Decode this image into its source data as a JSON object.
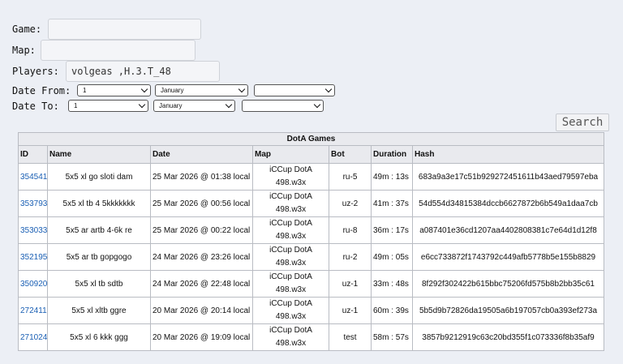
{
  "form": {
    "game_label": "Game:",
    "game_value": "",
    "map_label": "Map:",
    "map_value": "",
    "players_label": "Players:",
    "players_value": "volgeas ,H.3.T_48",
    "date_from_label": "Date From:",
    "date_to_label": "Date To:",
    "date_from": {
      "day": "1",
      "month": "January",
      "year": ""
    },
    "date_to": {
      "day": "1",
      "month": "January",
      "year": ""
    },
    "search_label": "Search"
  },
  "table": {
    "caption": "DotA Games",
    "headers": [
      "ID",
      "Name",
      "Date",
      "Map",
      "Bot",
      "Duration",
      "Hash"
    ],
    "rows": [
      {
        "id": "354541",
        "name": "5x5 xl go sloti dam",
        "date": "25 Mar 2026 @ 01:38 local",
        "map": "iCCup DotA 498.w3x",
        "bot": "ru-5",
        "duration": "49m : 13s",
        "hash": "683a9a3e17c51b929272451611b43aed79597eba"
      },
      {
        "id": "353793",
        "name": "5x5 xl tb 4 5kkkkkkk",
        "date": "25 Mar 2026 @ 00:56 local",
        "map": "iCCup DotA 498.w3x",
        "bot": "uz-2",
        "duration": "41m : 37s",
        "hash": "54d554d34815384dccb6627872b6b549a1daa7cb"
      },
      {
        "id": "353033",
        "name": "5x5 ar artb 4-6k re",
        "date": "25 Mar 2026 @ 00:22 local",
        "map": "iCCup DotA 498.w3x",
        "bot": "ru-8",
        "duration": "36m : 17s",
        "hash": "a087401e36cd1207aa4402808381c7e64d1d12f8"
      },
      {
        "id": "352195",
        "name": "5x5 ar tb gopgogo",
        "date": "24 Mar 2026 @ 23:26 local",
        "map": "iCCup DotA 498.w3x",
        "bot": "ru-2",
        "duration": "49m : 05s",
        "hash": "e6cc733872f1743792c449afb5778b5e155b8829"
      },
      {
        "id": "350920",
        "name": "5x5 xl tb sdtb",
        "date": "24 Mar 2026 @ 22:48 local",
        "map": "iCCup DotA 498.w3x",
        "bot": "uz-1",
        "duration": "33m : 48s",
        "hash": "8f292f302422b615bbc75206fd575b8b2bb35c61"
      },
      {
        "id": "272411",
        "name": "5x5 xl xltb ggre",
        "date": "20 Mar 2026 @ 20:14 local",
        "map": "iCCup DotA 498.w3x",
        "bot": "uz-1",
        "duration": "60m : 39s",
        "hash": "5b5d9b72826da19505a6b197057cb0a393ef273a"
      },
      {
        "id": "271024",
        "name": "5x5 xl 6 kkk ggg",
        "date": "20 Mar 2026 @ 19:09 local",
        "map": "iCCup DotA 498.w3x",
        "bot": "test",
        "duration": "58m : 57s",
        "hash": "3857b9212919c63c20bd355f1c073336f8b35af9"
      }
    ]
  }
}
